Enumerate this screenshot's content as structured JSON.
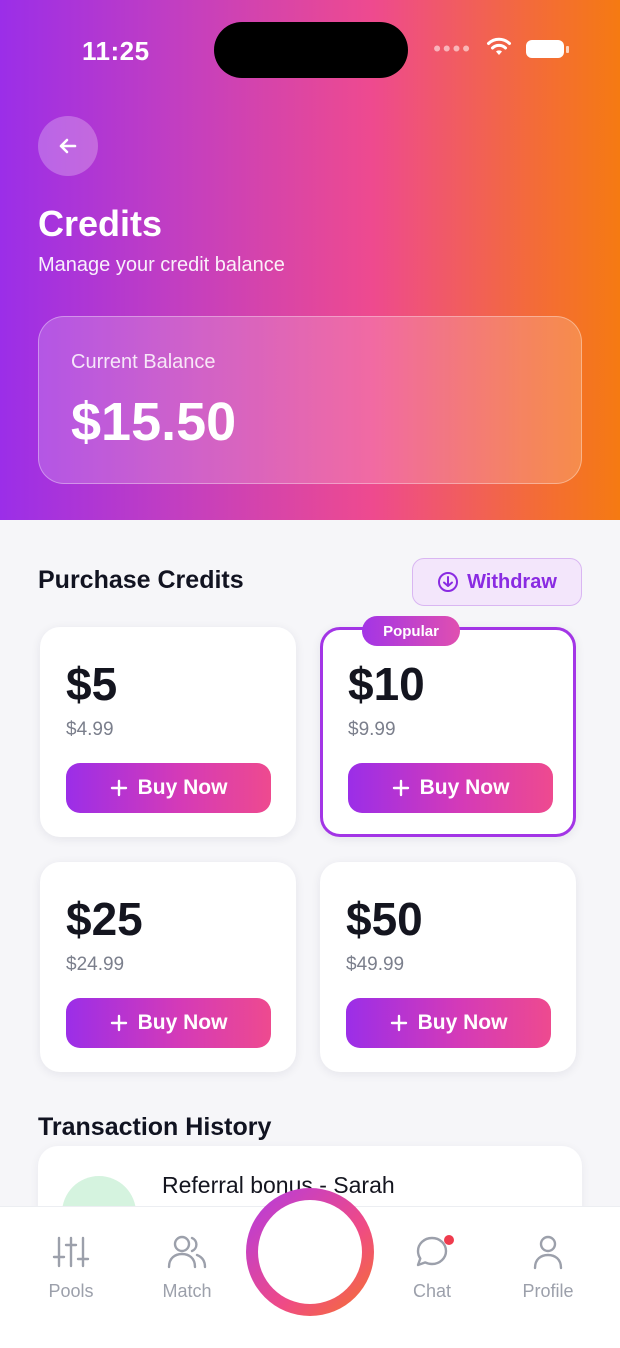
{
  "status_bar": {
    "time": "11:25"
  },
  "header": {
    "title": "Credits",
    "subtitle": "Manage your credit balance"
  },
  "balance": {
    "label": "Current Balance",
    "amount": "$15.50"
  },
  "purchase": {
    "title": "Purchase Credits",
    "withdraw_label": "Withdraw",
    "popular_badge": "Popular",
    "packages": [
      {
        "amount": "$5",
        "price": "$4.99",
        "button": "Buy Now"
      },
      {
        "amount": "$10",
        "price": "$9.99",
        "button": "Buy Now"
      },
      {
        "amount": "$25",
        "price": "$24.99",
        "button": "Buy Now"
      },
      {
        "amount": "$50",
        "price": "$49.99",
        "button": "Buy Now"
      }
    ]
  },
  "transactions": {
    "title": "Transaction History",
    "items": [
      {
        "title": "Referral bonus - Sarah"
      }
    ]
  },
  "nav": {
    "items": [
      {
        "label": "Pools",
        "icon": "sliders-icon"
      },
      {
        "label": "Match",
        "icon": "users-icon"
      },
      {
        "label": "Chat",
        "icon": "chat-bubble-icon"
      },
      {
        "label": "Profile",
        "icon": "person-icon"
      }
    ],
    "center_icon": "soundwave-logo-icon"
  },
  "colors": {
    "accent": "#9b2ee8",
    "gradient_end": "#f57a12",
    "pink": "#ee4a8f",
    "notification_dot": "#ef3b4d"
  }
}
